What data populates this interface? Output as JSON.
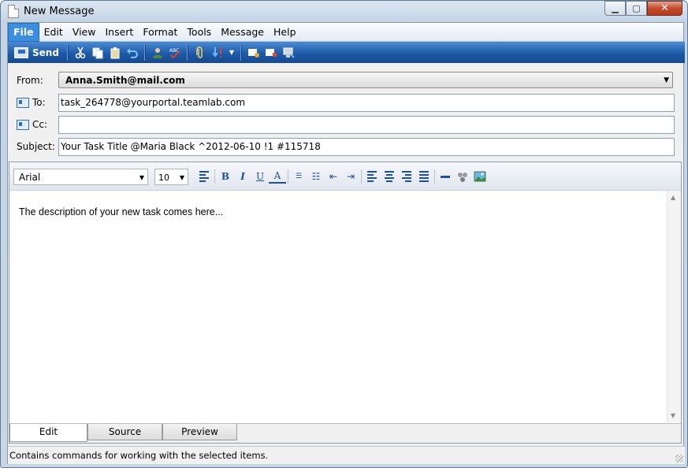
{
  "window": {
    "title": "New Message"
  },
  "menu": [
    "File",
    "Edit",
    "View",
    "Insert",
    "Format",
    "Tools",
    "Message",
    "Help"
  ],
  "toolbar": {
    "send_label": "Send"
  },
  "fields": {
    "from_label": "From:",
    "from_value": "Anna.Smith@mail.com",
    "to_label": "To:",
    "to_value": "task_264778@yourportal.teamlab.com",
    "cc_label": "Cc:",
    "cc_value": "",
    "subject_label": "Subject:",
    "subject_value": "Your Task Title @Maria Black ^2012-06-10 !1 #115718"
  },
  "format": {
    "font": "Arial",
    "size": "10"
  },
  "editor": {
    "body": "The description of your new task comes here..."
  },
  "tabs": [
    "Edit",
    "Source",
    "Preview"
  ],
  "status": {
    "text": "Contains commands for working with the selected items."
  },
  "colors": {
    "toolbar_blue": "#1e5aa8",
    "menu_active": "#3c8fe0",
    "format_icon": "#1b50a8"
  }
}
